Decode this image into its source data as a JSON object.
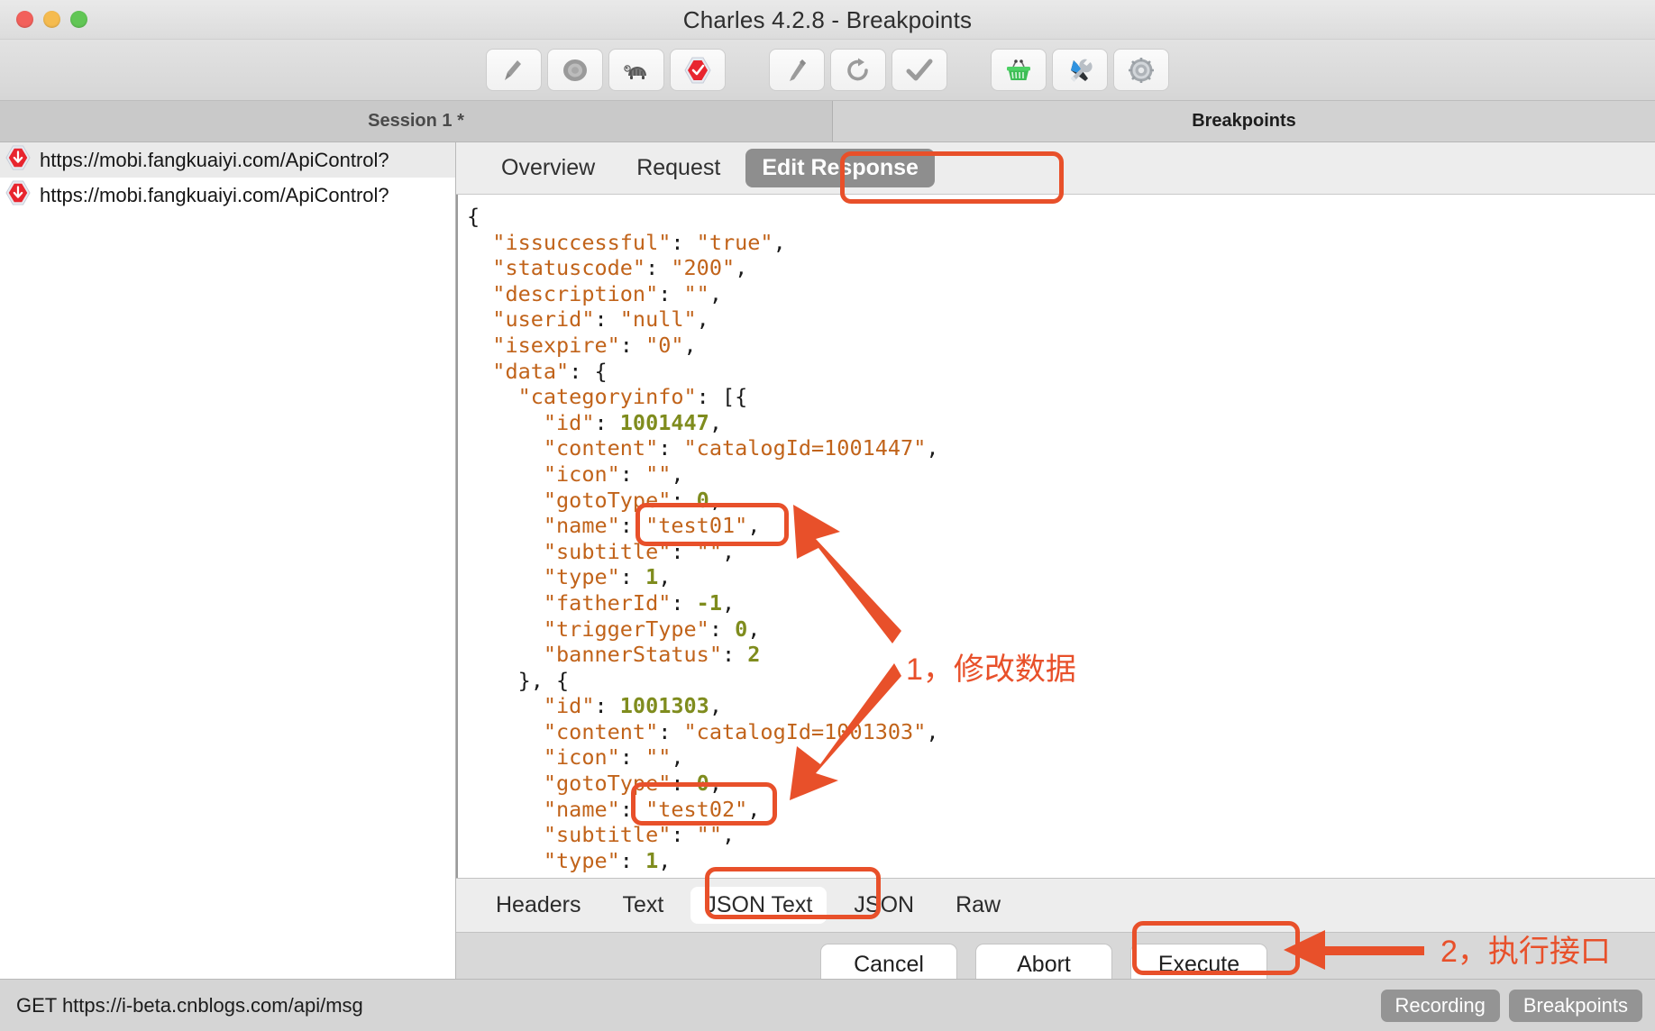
{
  "window": {
    "title": "Charles 4.2.8 - Breakpoints",
    "traffic_lights": [
      "close-button",
      "minimize-button",
      "zoom-button"
    ]
  },
  "toolbar": {
    "buttons": [
      {
        "name": "clear-session-button",
        "icon": "broom-icon"
      },
      {
        "name": "record-button",
        "icon": "record-icon"
      },
      {
        "name": "throttle-button",
        "icon": "turtle-icon"
      },
      {
        "name": "breakpoints-button",
        "icon": "stop-check-icon"
      },
      {
        "name": "compose-button",
        "icon": "pencil-icon"
      },
      {
        "name": "repeat-button",
        "icon": "refresh-icon"
      },
      {
        "name": "validate-button",
        "icon": "checkmark-icon"
      },
      {
        "name": "tools-basket-button",
        "icon": "basket-icon"
      },
      {
        "name": "tools-button",
        "icon": "wrench-screwdriver-icon"
      },
      {
        "name": "settings-button",
        "icon": "gear-icon"
      }
    ]
  },
  "tabstrip": {
    "session_tab": "Session 1 *",
    "breakpoints_tab": "Breakpoints"
  },
  "sidebar": {
    "sessions": [
      {
        "url": "https://mobi.fangkuaiyi.com/ApiControl?",
        "icon": "breakpoint-icon",
        "selected": true
      },
      {
        "url": "https://mobi.fangkuaiyi.com/ApiControl?",
        "icon": "breakpoint-icon",
        "selected": false
      }
    ]
  },
  "detail": {
    "top_tabs": [
      {
        "label": "Overview",
        "active": false
      },
      {
        "label": "Request",
        "active": false
      },
      {
        "label": "Edit Response",
        "active": true
      }
    ],
    "bottom_tabs": [
      {
        "label": "Headers",
        "active": false
      },
      {
        "label": "Text",
        "active": false
      },
      {
        "label": "JSON Text",
        "active": true
      },
      {
        "label": "JSON",
        "active": false
      },
      {
        "label": "Raw",
        "active": false
      }
    ],
    "actions": [
      {
        "label": "Cancel",
        "name": "cancel-button"
      },
      {
        "label": "Abort",
        "name": "abort-button"
      },
      {
        "label": "Execute",
        "name": "execute-button"
      }
    ]
  },
  "editor": {
    "lines": [
      [
        {
          "t": "{",
          "c": "punc"
        }
      ],
      [
        {
          "t": "  ",
          "c": "punc"
        },
        {
          "t": "\"issuccessful\"",
          "c": "key"
        },
        {
          "t": ": ",
          "c": "punc"
        },
        {
          "t": "\"true\"",
          "c": "str"
        },
        {
          "t": ",",
          "c": "punc"
        }
      ],
      [
        {
          "t": "  ",
          "c": "punc"
        },
        {
          "t": "\"statuscode\"",
          "c": "key"
        },
        {
          "t": ": ",
          "c": "punc"
        },
        {
          "t": "\"200\"",
          "c": "str"
        },
        {
          "t": ",",
          "c": "punc"
        }
      ],
      [
        {
          "t": "  ",
          "c": "punc"
        },
        {
          "t": "\"description\"",
          "c": "key"
        },
        {
          "t": ": ",
          "c": "punc"
        },
        {
          "t": "\"\"",
          "c": "str"
        },
        {
          "t": ",",
          "c": "punc"
        }
      ],
      [
        {
          "t": "  ",
          "c": "punc"
        },
        {
          "t": "\"userid\"",
          "c": "key"
        },
        {
          "t": ": ",
          "c": "punc"
        },
        {
          "t": "\"null\"",
          "c": "str"
        },
        {
          "t": ",",
          "c": "punc"
        }
      ],
      [
        {
          "t": "  ",
          "c": "punc"
        },
        {
          "t": "\"isexpire\"",
          "c": "key"
        },
        {
          "t": ": ",
          "c": "punc"
        },
        {
          "t": "\"0\"",
          "c": "str"
        },
        {
          "t": ",",
          "c": "punc"
        }
      ],
      [
        {
          "t": "  ",
          "c": "punc"
        },
        {
          "t": "\"data\"",
          "c": "key"
        },
        {
          "t": ": {",
          "c": "punc"
        }
      ],
      [
        {
          "t": "    ",
          "c": "punc"
        },
        {
          "t": "\"categoryinfo\"",
          "c": "key"
        },
        {
          "t": ": [{",
          "c": "punc"
        }
      ],
      [
        {
          "t": "      ",
          "c": "punc"
        },
        {
          "t": "\"id\"",
          "c": "key"
        },
        {
          "t": ": ",
          "c": "punc"
        },
        {
          "t": "1001447",
          "c": "num"
        },
        {
          "t": ",",
          "c": "punc"
        }
      ],
      [
        {
          "t": "      ",
          "c": "punc"
        },
        {
          "t": "\"content\"",
          "c": "key"
        },
        {
          "t": ": ",
          "c": "punc"
        },
        {
          "t": "\"catalogId=1001447\"",
          "c": "str"
        },
        {
          "t": ",",
          "c": "punc"
        }
      ],
      [
        {
          "t": "      ",
          "c": "punc"
        },
        {
          "t": "\"icon\"",
          "c": "key"
        },
        {
          "t": ": ",
          "c": "punc"
        },
        {
          "t": "\"\"",
          "c": "str"
        },
        {
          "t": ",",
          "c": "punc"
        }
      ],
      [
        {
          "t": "      ",
          "c": "punc"
        },
        {
          "t": "\"gotoType\"",
          "c": "key"
        },
        {
          "t": ": ",
          "c": "punc"
        },
        {
          "t": "0",
          "c": "num"
        },
        {
          "t": ",",
          "c": "punc"
        }
      ],
      [
        {
          "t": "      ",
          "c": "punc"
        },
        {
          "t": "\"name\"",
          "c": "key"
        },
        {
          "t": ": ",
          "c": "punc"
        },
        {
          "t": "\"test01\"",
          "c": "str"
        },
        {
          "t": ",",
          "c": "punc"
        }
      ],
      [
        {
          "t": "      ",
          "c": "punc"
        },
        {
          "t": "\"subtitle\"",
          "c": "key"
        },
        {
          "t": ": ",
          "c": "punc"
        },
        {
          "t": "\"\"",
          "c": "str"
        },
        {
          "t": ",",
          "c": "punc"
        }
      ],
      [
        {
          "t": "      ",
          "c": "punc"
        },
        {
          "t": "\"type\"",
          "c": "key"
        },
        {
          "t": ": ",
          "c": "punc"
        },
        {
          "t": "1",
          "c": "num"
        },
        {
          "t": ",",
          "c": "punc"
        }
      ],
      [
        {
          "t": "      ",
          "c": "punc"
        },
        {
          "t": "\"fatherId\"",
          "c": "key"
        },
        {
          "t": ": ",
          "c": "punc"
        },
        {
          "t": "-1",
          "c": "num"
        },
        {
          "t": ",",
          "c": "punc"
        }
      ],
      [
        {
          "t": "      ",
          "c": "punc"
        },
        {
          "t": "\"triggerType\"",
          "c": "key"
        },
        {
          "t": ": ",
          "c": "punc"
        },
        {
          "t": "0",
          "c": "num"
        },
        {
          "t": ",",
          "c": "punc"
        }
      ],
      [
        {
          "t": "      ",
          "c": "punc"
        },
        {
          "t": "\"bannerStatus\"",
          "c": "key"
        },
        {
          "t": ": ",
          "c": "punc"
        },
        {
          "t": "2",
          "c": "num"
        }
      ],
      [
        {
          "t": "    }, {",
          "c": "punc"
        }
      ],
      [
        {
          "t": "      ",
          "c": "punc"
        },
        {
          "t": "\"id\"",
          "c": "key"
        },
        {
          "t": ": ",
          "c": "punc"
        },
        {
          "t": "1001303",
          "c": "num"
        },
        {
          "t": ",",
          "c": "punc"
        }
      ],
      [
        {
          "t": "      ",
          "c": "punc"
        },
        {
          "t": "\"content\"",
          "c": "key"
        },
        {
          "t": ": ",
          "c": "punc"
        },
        {
          "t": "\"catalogId=1001303\"",
          "c": "str"
        },
        {
          "t": ",",
          "c": "punc"
        }
      ],
      [
        {
          "t": "      ",
          "c": "punc"
        },
        {
          "t": "\"icon\"",
          "c": "key"
        },
        {
          "t": ": ",
          "c": "punc"
        },
        {
          "t": "\"\"",
          "c": "str"
        },
        {
          "t": ",",
          "c": "punc"
        }
      ],
      [
        {
          "t": "      ",
          "c": "punc"
        },
        {
          "t": "\"gotoType\"",
          "c": "key"
        },
        {
          "t": ": ",
          "c": "punc"
        },
        {
          "t": "0",
          "c": "num"
        },
        {
          "t": ",",
          "c": "punc"
        }
      ],
      [
        {
          "t": "      ",
          "c": "punc"
        },
        {
          "t": "\"name\"",
          "c": "key"
        },
        {
          "t": ": ",
          "c": "punc"
        },
        {
          "t": "\"test02\"",
          "c": "str"
        },
        {
          "t": ",",
          "c": "punc"
        }
      ],
      [
        {
          "t": "      ",
          "c": "punc"
        },
        {
          "t": "\"subtitle\"",
          "c": "key"
        },
        {
          "t": ": ",
          "c": "punc"
        },
        {
          "t": "\"\"",
          "c": "str"
        },
        {
          "t": ",",
          "c": "punc"
        }
      ],
      [
        {
          "t": "      ",
          "c": "punc"
        },
        {
          "t": "\"type\"",
          "c": "key"
        },
        {
          "t": ": ",
          "c": "punc"
        },
        {
          "t": "1",
          "c": "num"
        },
        {
          "t": ",",
          "c": "punc"
        }
      ]
    ]
  },
  "statusbar": {
    "request": "GET https://i-beta.cnblogs.com/api/msg",
    "recording_label": "Recording",
    "breakpoints_label": "Breakpoints"
  },
  "annotations": {
    "accent_color": "#e8502a",
    "step1_text": "1，修改数据",
    "step2_text": "2，执行接口"
  }
}
